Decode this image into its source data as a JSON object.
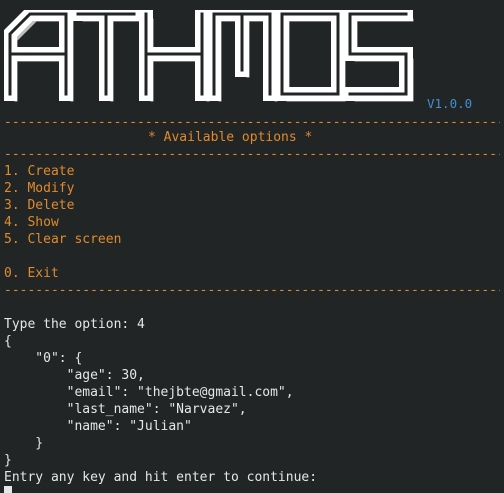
{
  "banner": {
    "logo_text": "ATHMOS",
    "version": "V1.0.0"
  },
  "menu": {
    "divider": "------------------------------------------------------------------------------------------------",
    "title": "* Available options *",
    "options": [
      "1. Create",
      "2. Modify",
      "3. Delete",
      "4. Show",
      "5. Clear screen"
    ],
    "exit_option": "0. Exit"
  },
  "session": {
    "prompt": "Type the option: 4",
    "output_lines": [
      "{",
      "    \"0\": {",
      "        \"age\": 30,",
      "        \"email\": \"thejbte@gmail.com\",",
      "        \"last_name\": \"Narvaez\",",
      "        \"name\": \"Julian\"",
      "    }",
      "}"
    ],
    "continue_prompt": "Entry any key and hit enter to continue:"
  },
  "colors": {
    "background": "#222526",
    "accent_orange": "#e08a2c",
    "version_blue": "#3f8fd2",
    "text": "#e6e6e6"
  }
}
